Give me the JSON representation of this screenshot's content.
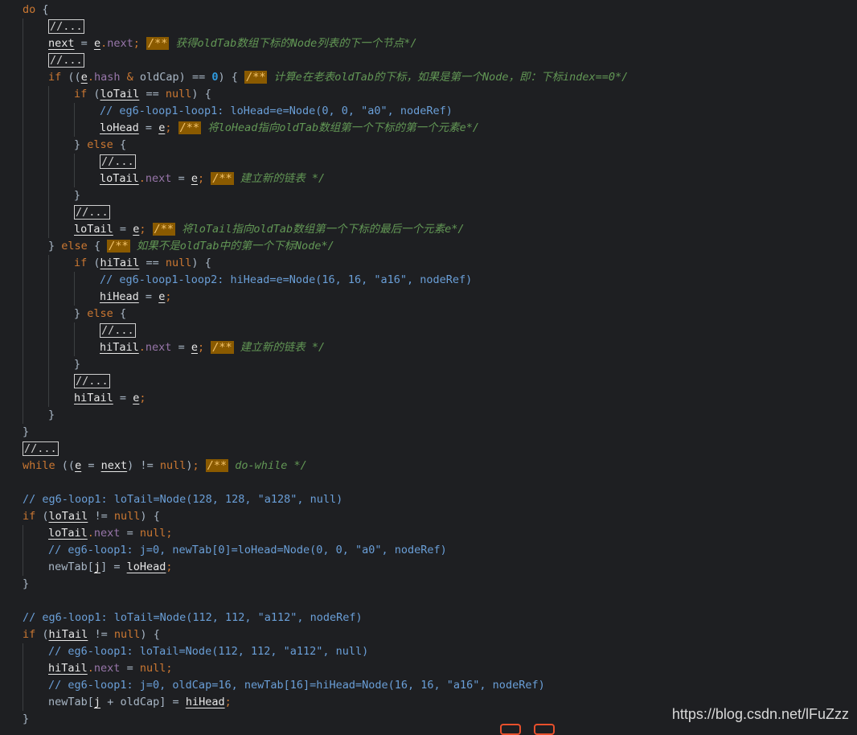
{
  "editor": {
    "theme": "dark",
    "colors": {
      "background": "#1e1f22",
      "keyword": "#cc7832",
      "field": "#9876aa",
      "string": "#6a8759",
      "comment": "#629755"
    }
  },
  "code": {
    "lines": [
      "do {",
      "    //...",
      "    next = e.next; /** 获得oldTab数组下标的Node列表的下一个节点*/",
      "    //...",
      "    if ((e.hash & oldCap) == 0) { /** 计算e在老表oldTab的下标，如果是第一个Node，即：下标index==0*/",
      "        if (loTail == null) {",
      "            // eg6-loop1-loop1: loHead=e=Node(0, 0, \"a0\", nodeRef)",
      "            loHead = e; /** 将loHead指向oldTab数组第一个下标的第一个元素e*/",
      "        } else {",
      "            //...",
      "            loTail.next = e; /** 建立新的链表 */",
      "        }",
      "        //...",
      "        loTail = e; /** 将loTail指向oldTab数组第一个下标的最后一个元素e*/",
      "    } else { /** 如果不是oldTab中的第一个下标Node*/",
      "        if (hiTail == null) {",
      "            // eg6-loop1-loop2: hiHead=e=Node(16, 16, \"a16\", nodeRef)",
      "            hiHead = e;",
      "        } else {",
      "            //...",
      "            hiTail.next = e; /** 建立新的链表 */",
      "        }",
      "        //...",
      "        hiTail = e;",
      "    }",
      "}",
      "//...",
      "while ((e = next) != null); /** do-while */",
      "",
      "// eg6-loop1: loTail=Node(128, 128, \"a128\", null)",
      "if (loTail != null) {",
      "    loTail.next = null;",
      "    // eg6-loop1: j=0, newTab[0]=loHead=Node(0, 0, \"a0\", nodeRef)",
      "    newTab[j] = loHead;",
      "}",
      "",
      "// eg6-loop1: loTail=Node(112, 112, \"a112\", nodeRef)",
      "if (hiTail != null) {",
      "    // eg6-loop1: loTail=Node(112, 112, \"a112\", null)",
      "    hiTail.next = null;",
      "    // eg6-loop1: j=0, oldCap=16, newTab[16]=hiHead=Node(16, 16, \"a16\", nodeRef)",
      "    newTab[j + oldCap] = hiHead;",
      "}"
    ]
  },
  "watermark": "https://blog.csdn.net/lFuZzz"
}
